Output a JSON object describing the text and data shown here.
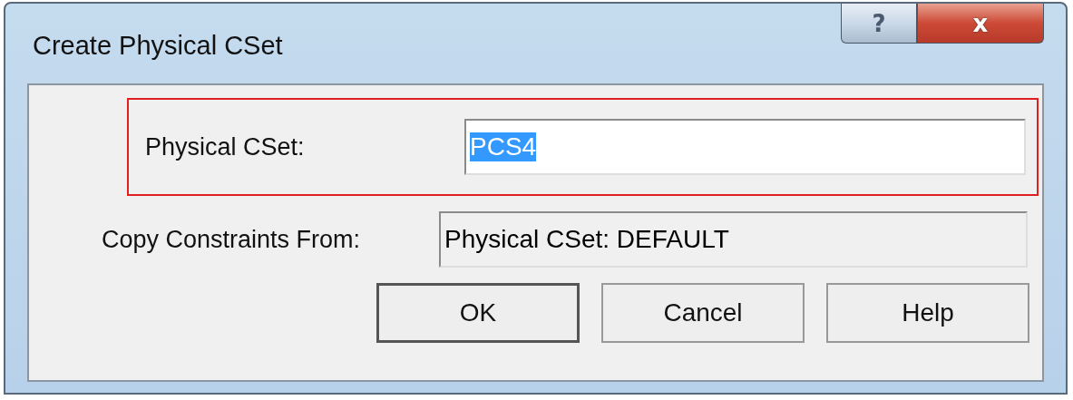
{
  "window": {
    "title": "Create Physical CSet",
    "help_button": "?",
    "close_button": "x"
  },
  "fields": [
    {
      "label": "Physical CSet:",
      "value": "PCS4",
      "highlighted": true,
      "text_selected": true,
      "readonly": false
    },
    {
      "label": "Copy Constraints From:",
      "value": "Physical CSet: DEFAULT",
      "highlighted": false,
      "text_selected": false,
      "readonly": true
    }
  ],
  "buttons": [
    {
      "label": "OK",
      "default": true
    },
    {
      "label": "Cancel",
      "default": false
    },
    {
      "label": "Help",
      "default": false
    }
  ]
}
